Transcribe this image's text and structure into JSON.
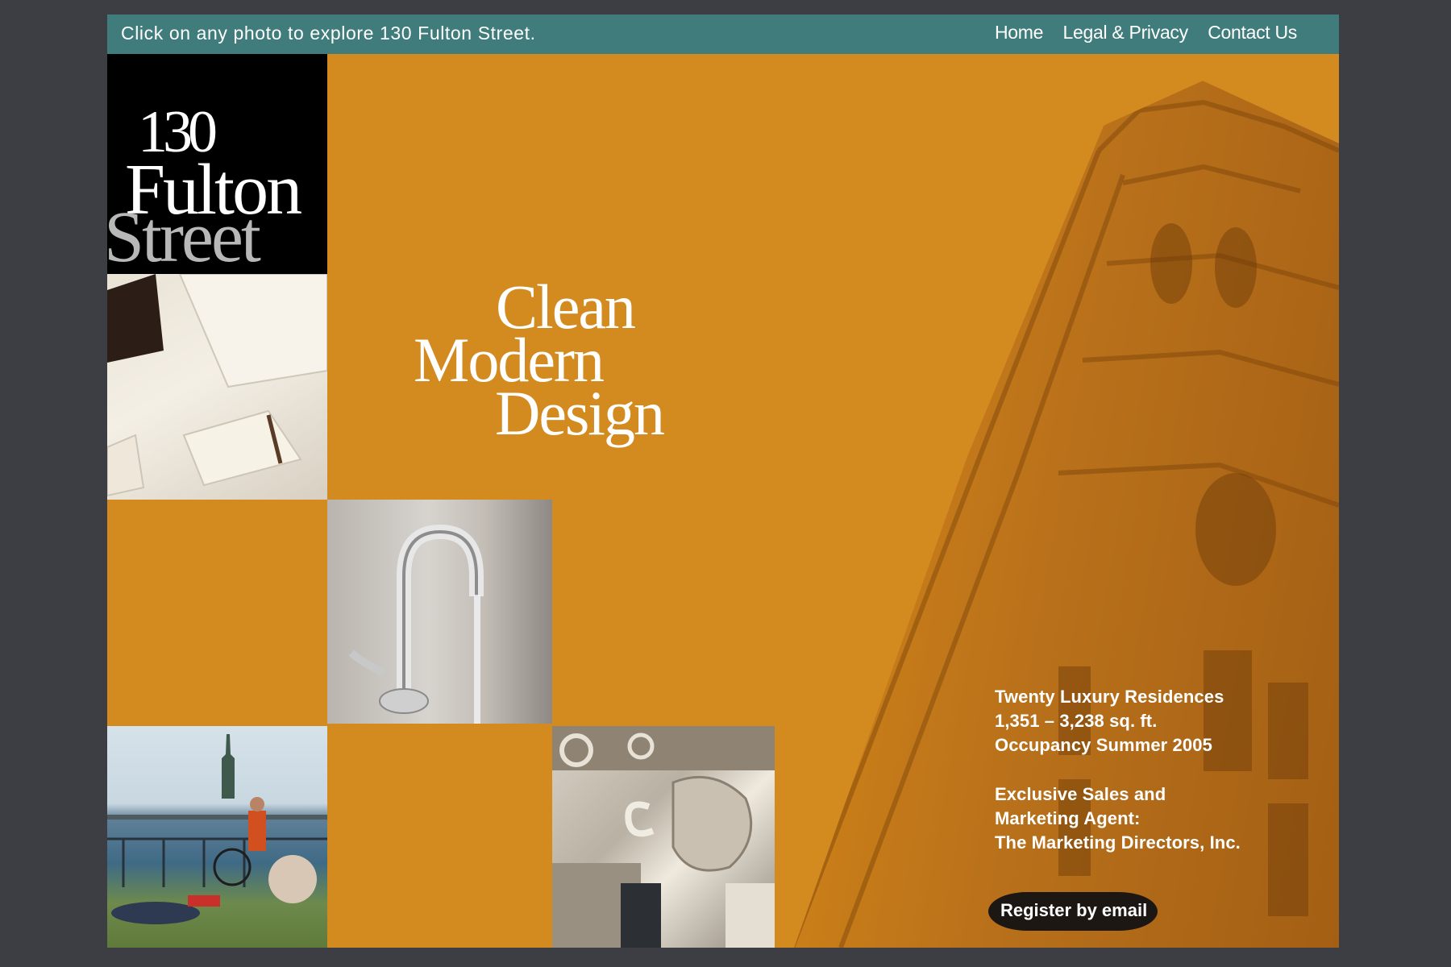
{
  "topbar": {
    "instruction": "Click on any photo to explore 130 Fulton Street.",
    "nav": [
      "Home",
      "Legal & Privacy",
      "Contact Us"
    ]
  },
  "logo": {
    "line1": "130",
    "line2": "Fulton",
    "line3": "Street"
  },
  "headline": {
    "line1": "Clean",
    "line2": "Modern",
    "line3": "Design"
  },
  "info": {
    "block1": [
      "Twenty Luxury Residences",
      "1,351 – 3,238 sq. ft.",
      "Occupancy Summer 2005"
    ],
    "block2": [
      "Exclusive Sales and",
      "Marketing Agent:",
      "The Marketing Directors, Inc."
    ]
  },
  "register_label": "Register by email",
  "colors": {
    "background": "#3d3e44",
    "topbar": "#3f7c7b",
    "accent_orange": "#d38b1f"
  }
}
